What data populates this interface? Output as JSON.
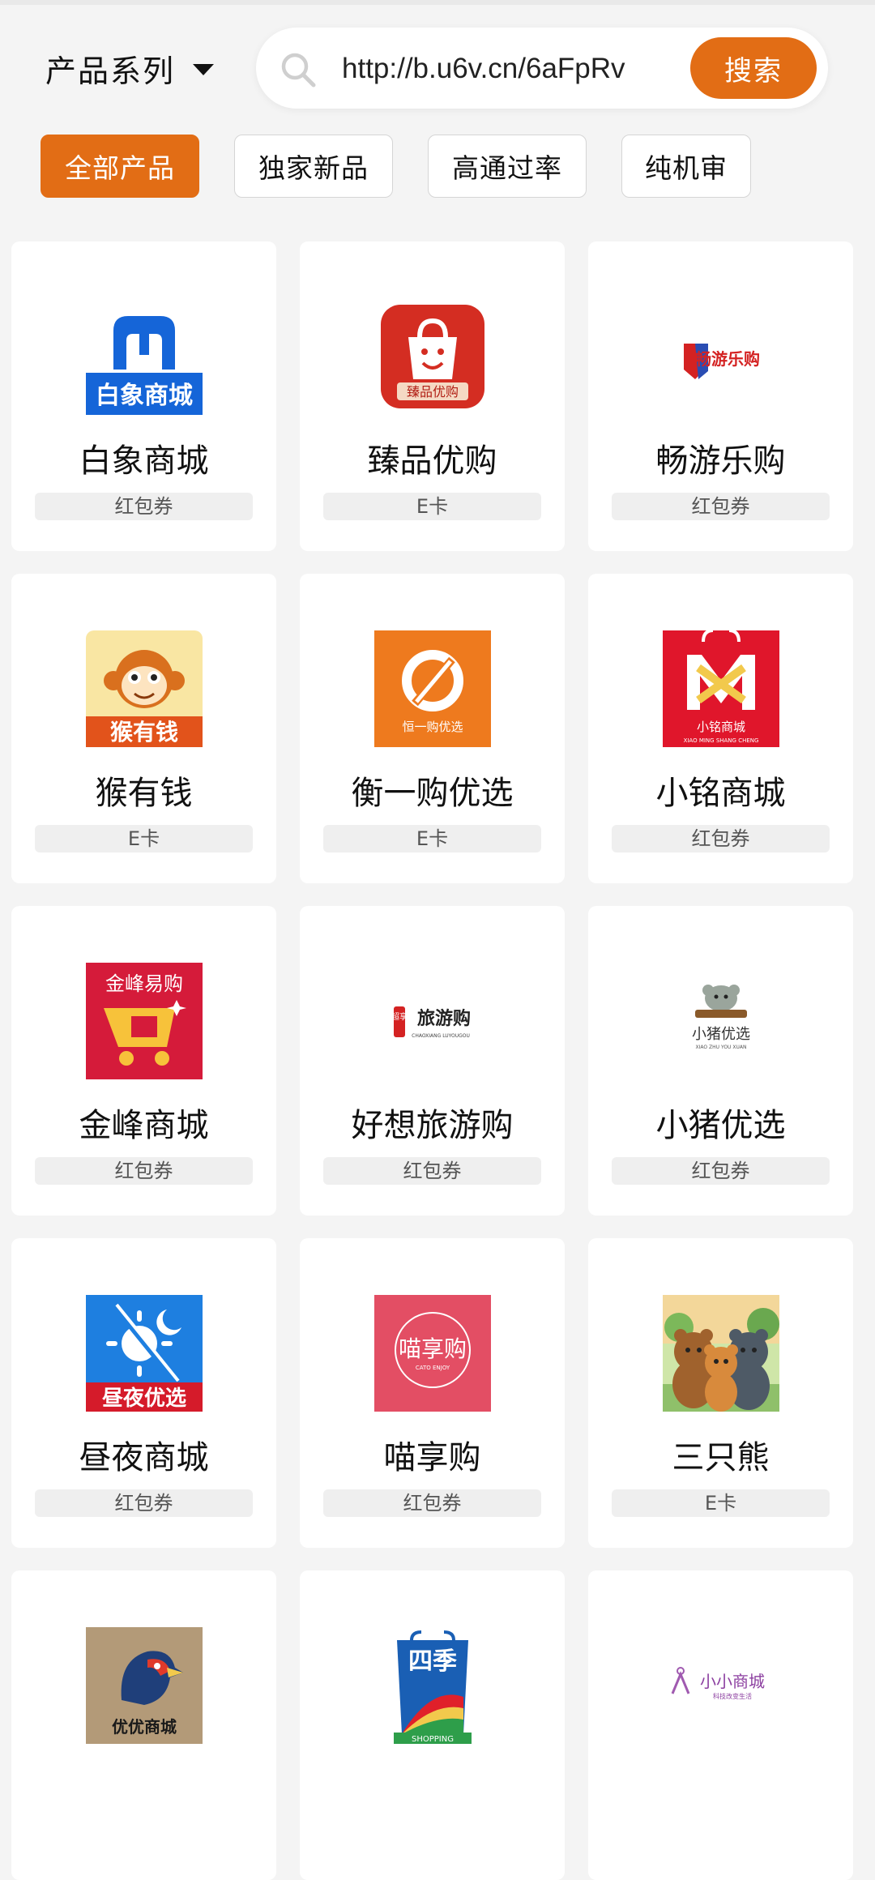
{
  "header": {
    "series_label": "产品系列",
    "search_value": "http://b.u6v.cn/6aFpRv",
    "search_button": "搜索"
  },
  "tabs": [
    "全部产品",
    "独家新品",
    "高通过率",
    "纯机审"
  ],
  "active_tab": 0,
  "colors": {
    "accent": "#e26d15",
    "background": "#f4f4f4"
  },
  "products": [
    {
      "name": "白象商城",
      "tag": "红包券",
      "logo_text": "白象商城",
      "logo": "baixiang-logo"
    },
    {
      "name": "臻品优购",
      "tag": "E卡",
      "logo_text": "臻品优购",
      "logo": "zhenpin-logo"
    },
    {
      "name": "畅游乐购",
      "tag": "红包券",
      "logo_text": "畅游乐购",
      "logo": "changyou-logo"
    },
    {
      "name": "猴有钱",
      "tag": "E卡",
      "logo_text": "猴有钱",
      "logo": "houyouqian-logo"
    },
    {
      "name": "衡一购优选",
      "tag": "E卡",
      "logo_text": "恒一购优选",
      "logo": "hengyigou-logo"
    },
    {
      "name": "小铭商城",
      "tag": "红包券",
      "logo_text": "小铭商城",
      "logo_subtext": "XIAO MING SHANG CHENG",
      "logo": "xiaoming-logo"
    },
    {
      "name": "金峰商城",
      "tag": "红包券",
      "logo_text": "金峰易购",
      "logo": "jinfeng-logo"
    },
    {
      "name": "好想旅游购",
      "tag": "红包券",
      "logo_text": "旅游购",
      "logo_side": "超享",
      "logo_subtext": "CHAOXIANG LUYOUGOU",
      "logo": "lvyougou-logo"
    },
    {
      "name": "小猪优选",
      "tag": "红包券",
      "logo_text": "小猪优选",
      "logo_subtext": "XIAO ZHU YOU XUAN",
      "logo": "xiaozhu-logo"
    },
    {
      "name": "昼夜商城",
      "tag": "红包券",
      "logo_text": "昼夜优选",
      "logo": "zhouye-logo"
    },
    {
      "name": "喵享购",
      "tag": "红包券",
      "logo_text": "喵享购",
      "logo_subtext": "CATO ENJOY",
      "logo": "miaoxiang-logo"
    },
    {
      "name": "三只熊",
      "tag": "E卡",
      "logo_text": "",
      "logo": "bears-logo"
    },
    {
      "name": "",
      "tag": "",
      "logo_text": "优优商城",
      "logo": "youyou-logo"
    },
    {
      "name": "",
      "tag": "",
      "logo_text": "四季",
      "logo_subtext": "SHOPPING",
      "logo": "siji-logo"
    },
    {
      "name": "",
      "tag": "",
      "logo_text": "小小商城",
      "logo_subtext": "科技改变生活",
      "logo": "xiaoxiao-logo"
    }
  ]
}
